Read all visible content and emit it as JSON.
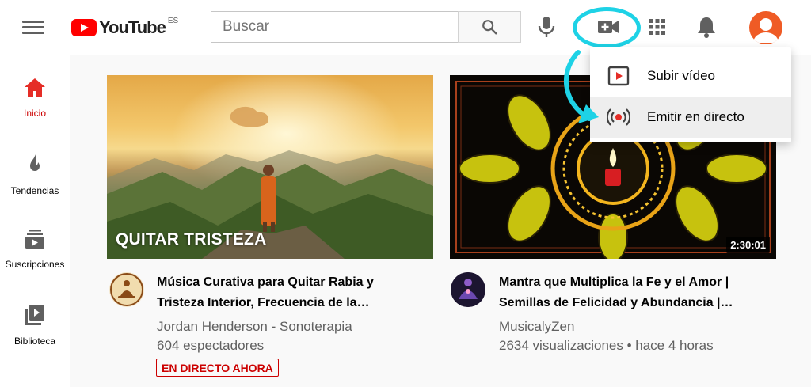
{
  "header": {
    "logo_text": "YouTube",
    "logo_country": "ES",
    "search_placeholder": "Buscar",
    "icons": [
      "menu-icon",
      "search-icon",
      "mic-icon",
      "create-video-icon",
      "apps-icon",
      "bell-icon",
      "account-icon"
    ]
  },
  "sidebar": {
    "items": [
      {
        "label": "Inicio",
        "icon": "home-icon",
        "active": true
      },
      {
        "label": "Tendencias",
        "icon": "flame-icon"
      },
      {
        "label": "Suscripciones",
        "icon": "subscriptions-icon"
      },
      {
        "label": "Biblioteca",
        "icon": "library-icon"
      }
    ]
  },
  "create_menu": {
    "items": [
      {
        "label": "Subir vídeo",
        "icon": "upload-video-icon"
      },
      {
        "label": "Emitir en directo",
        "icon": "go-live-icon"
      }
    ]
  },
  "videos": [
    {
      "thumb_text": "QUITAR TRISTEZA",
      "title_line1": "Música Curativa para Quitar Rabia y",
      "title_line2": "Tristeza Interior, Frecuencia de la…",
      "channel": "Jordan Henderson - Sonoterapia",
      "stats": "604 espectadores",
      "badge": "EN DIRECTO AHORA"
    },
    {
      "duration": "2:30:01",
      "title_line1": "Mantra que Multiplica la Fe y el Amor |",
      "title_line2": "Semillas de Felicidad y Abundancia |…",
      "channel": "MusicalyZen",
      "stats": "2634 visualizaciones • hace 4 horas"
    }
  ],
  "colors": {
    "brand_red": "#ff0000",
    "highlight_cyan": "#1ed2e6",
    "avatar_orange": "#ef5b25",
    "live_red": "#cc0000"
  }
}
